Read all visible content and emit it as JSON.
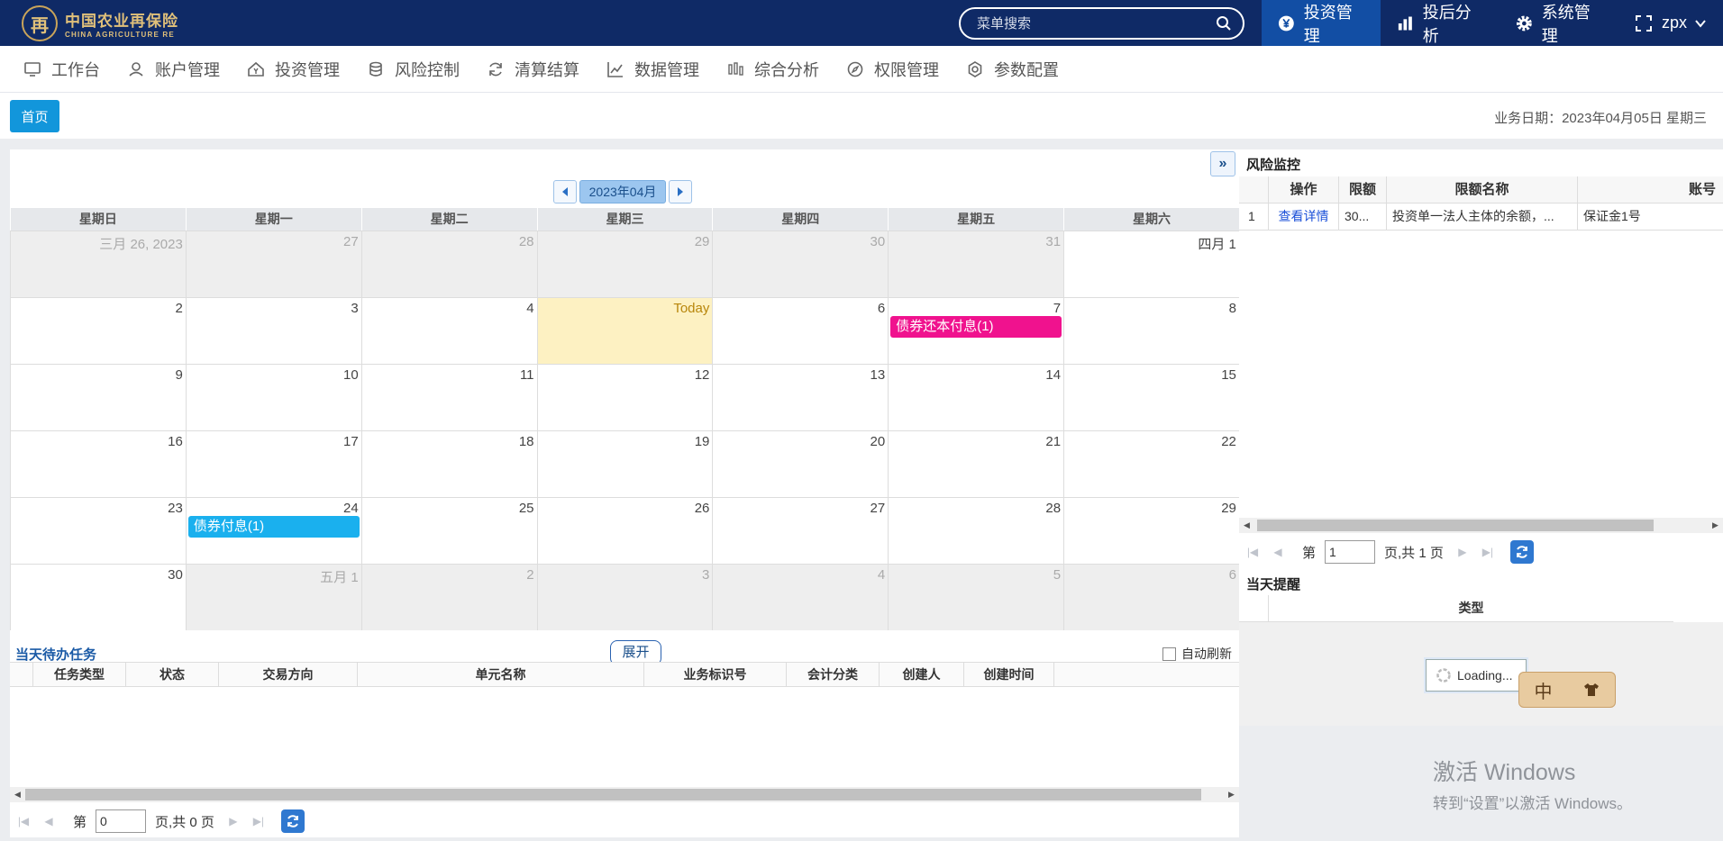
{
  "brand": {
    "seal": "再",
    "name_cn": "中国农业再保险",
    "name_en": "CHINA AGRICULTURE RE"
  },
  "search": {
    "placeholder": "菜单搜索",
    "icon": "search-icon"
  },
  "topnav": [
    {
      "label": "投资管理",
      "icon": "yen-icon",
      "active": true
    },
    {
      "label": "投后分析",
      "icon": "bar-chart-icon"
    },
    {
      "label": "系统管理",
      "icon": "gear-icon"
    },
    {
      "label": "zpx",
      "icon": "fullscreen-icon",
      "suffix_icon": "chevron-down-icon"
    }
  ],
  "menu": [
    {
      "label": "工作台",
      "icon": "monitor-icon"
    },
    {
      "label": "账户管理",
      "icon": "user-icon"
    },
    {
      "label": "投资管理",
      "icon": "home-yen-icon"
    },
    {
      "label": "风险控制",
      "icon": "database-icon"
    },
    {
      "label": "清算结算",
      "icon": "exchange-icon"
    },
    {
      "label": "数据管理",
      "icon": "line-chart-icon"
    },
    {
      "label": "综合分析",
      "icon": "candlestick-icon"
    },
    {
      "label": "权限管理",
      "icon": "compass-icon"
    },
    {
      "label": "参数配置",
      "icon": "settings-icon"
    }
  ],
  "tabs": {
    "home": "首页"
  },
  "biz_date": "业务日期：2023年04月05日  星期三",
  "calendar": {
    "month_label": "2023年04月",
    "weekdays": [
      "星期日",
      "星期一",
      "星期二",
      "星期三",
      "星期四",
      "星期五",
      "星期六"
    ],
    "weeks": [
      [
        {
          "d": "三月 26, 2023",
          "o": 1
        },
        {
          "d": "27",
          "o": 1
        },
        {
          "d": "28",
          "o": 1
        },
        {
          "d": "29",
          "o": 1
        },
        {
          "d": "30",
          "o": 1
        },
        {
          "d": "31",
          "o": 1
        },
        {
          "d": "四月 1"
        }
      ],
      [
        {
          "d": "2"
        },
        {
          "d": "3"
        },
        {
          "d": "4"
        },
        {
          "d": "Today",
          "t": 1
        },
        {
          "d": "6"
        },
        {
          "d": "7",
          "e": "债券还本付息(1)",
          "ec": "pink"
        },
        {
          "d": "8"
        }
      ],
      [
        {
          "d": "9"
        },
        {
          "d": "10"
        },
        {
          "d": "11"
        },
        {
          "d": "12"
        },
        {
          "d": "13"
        },
        {
          "d": "14"
        },
        {
          "d": "15"
        }
      ],
      [
        {
          "d": "16"
        },
        {
          "d": "17"
        },
        {
          "d": "18"
        },
        {
          "d": "19"
        },
        {
          "d": "20"
        },
        {
          "d": "21"
        },
        {
          "d": "22"
        }
      ],
      [
        {
          "d": "23"
        },
        {
          "d": "24",
          "e": "债券付息(1)",
          "ec": "blue"
        },
        {
          "d": "25"
        },
        {
          "d": "26"
        },
        {
          "d": "27"
        },
        {
          "d": "28"
        },
        {
          "d": "29"
        }
      ],
      [
        {
          "d": "30"
        },
        {
          "d": "五月 1",
          "o": 1
        },
        {
          "d": "2",
          "o": 1
        },
        {
          "d": "3",
          "o": 1
        },
        {
          "d": "4",
          "o": 1
        },
        {
          "d": "5",
          "o": 1
        },
        {
          "d": "6",
          "o": 1
        }
      ]
    ]
  },
  "tasks": {
    "title": "当天待办任务",
    "expand": "展开",
    "auto_refresh": "自动刷新",
    "columns": [
      "任务类型",
      "状态",
      "交易方向",
      "单元名称",
      "业务标识号",
      "会计分类",
      "创建人",
      "创建时间"
    ],
    "pager": {
      "prefix": "第",
      "page": "0",
      "suffix": "页,共 0 页"
    }
  },
  "risk": {
    "title": "风险监控",
    "columns": [
      "操作",
      "限额",
      "限额名称",
      "账号"
    ],
    "rows": [
      {
        "no": "1",
        "action": "查看详情",
        "limit": "30...",
        "name": "投资单一法人主体的余额，...",
        "account": "保证金1号"
      }
    ],
    "pager": {
      "prefix": "第",
      "page": "1",
      "suffix": "页,共 1 页"
    }
  },
  "remind": {
    "title": "当天提醒",
    "columns": [
      "类型"
    ],
    "loading": "Loading..."
  },
  "ime": {
    "lang": "中",
    "icon": "shirt-icon"
  },
  "watermark": {
    "line1": "激活 Windows",
    "line2": "转到“设置”以激活 Windows。"
  },
  "colors": {
    "topbar": "#0f2a66",
    "accent": "#1296db",
    "event_pink": "#f0128e",
    "event_blue": "#1ab0ee",
    "today": "#fdf1c2"
  }
}
